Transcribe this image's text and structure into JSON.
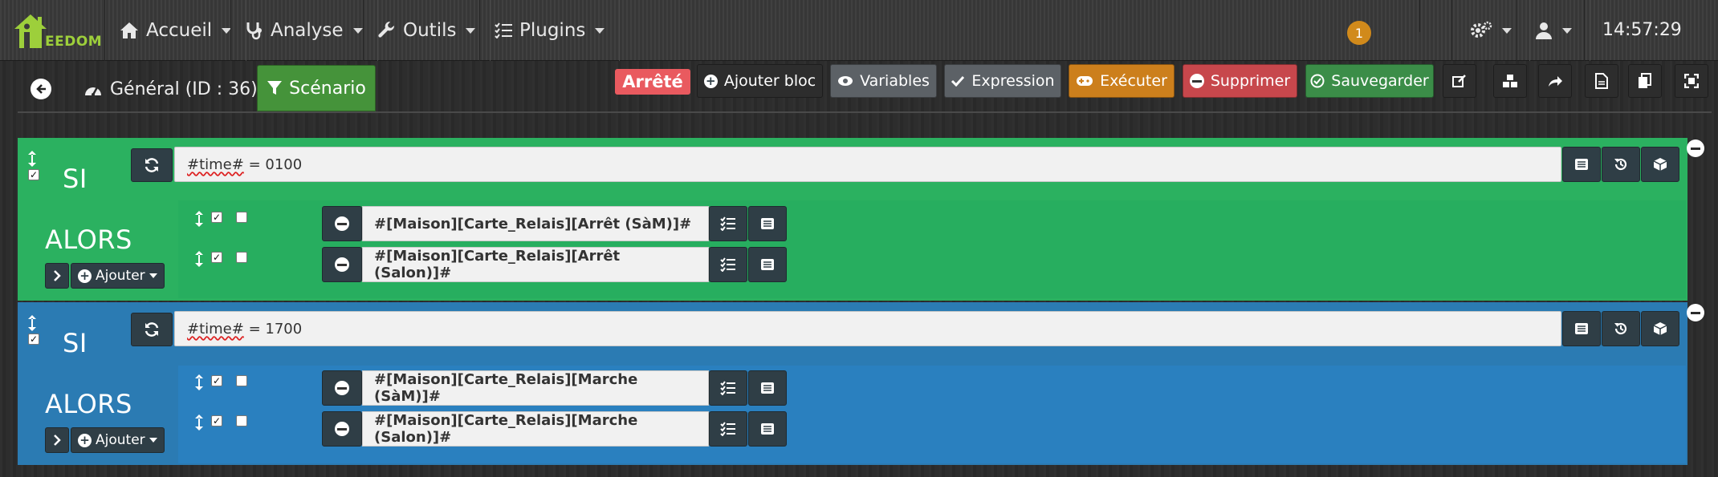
{
  "nav": {
    "logo_text": "EEDOM",
    "items": [
      {
        "label": "Accueil",
        "icon": "home-icon"
      },
      {
        "label": "Analyse",
        "icon": "stethoscope-icon"
      },
      {
        "label": "Outils",
        "icon": "wrench-icon"
      },
      {
        "label": "Plugins",
        "icon": "tasks-icon"
      }
    ],
    "notification_count": "1",
    "clock": "14:57:29"
  },
  "scenario": {
    "title": "Général (ID : 36)",
    "tab_label": "Scénario",
    "status": "Arrêté",
    "toolbar": {
      "add_block": "Ajouter bloc",
      "variables": "Variables",
      "expression": "Expression",
      "execute": "Exécuter",
      "delete": "Supprimer",
      "save": "Sauvegarder"
    }
  },
  "blocks": [
    {
      "if_label": "SI",
      "condition_var": "#time#",
      "condition_rest": " = 0100",
      "then_label": "ALORS",
      "add_label": "Ajouter",
      "actions": [
        {
          "command": "#[Maison][Carte_Relais][Arrêt (SàM)]#"
        },
        {
          "command": "#[Maison][Carte_Relais][Arrêt (Salon)]#"
        }
      ]
    },
    {
      "if_label": "SI",
      "condition_var": "#time#",
      "condition_rest": " = 1700",
      "then_label": "ALORS",
      "add_label": "Ajouter",
      "actions": [
        {
          "command": "#[Maison][Carte_Relais][Marche (SàM)]#"
        },
        {
          "command": "#[Maison][Carte_Relais][Marche (Salon)]#"
        }
      ]
    }
  ],
  "colors": {
    "block1": "#2bb160",
    "block2": "#2b7bb3",
    "status": "#e95a5f",
    "accent": "#45933a"
  }
}
